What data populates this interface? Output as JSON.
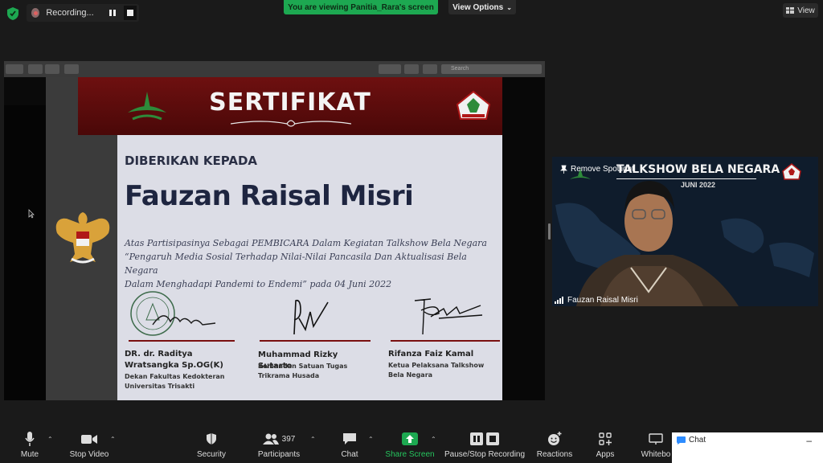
{
  "recording": {
    "label": "Recording..."
  },
  "banner": {
    "viewing": "You are viewing Panitia_Rara's screen",
    "view_options": "View Options"
  },
  "view_button": "View",
  "pdf": {
    "search_placeholder": "Search"
  },
  "certificate": {
    "title": "SERTIFIKAT",
    "given_to": "DIBERIKAN KEPADA",
    "recipient": "Fauzan Raisal Misri",
    "description_lines": [
      "Atas Partisipasinya Sebagai PEMBICARA Dalam Kegiatan Talkshow Bela Negara",
      "“Pengaruh Media Sosial Terhadap Nilai-Nilai Pancasila Dan Aktualisasi Bela Negara",
      "Dalam Menghadapi Pandemi to Endemi” pada 04 Juni 2022"
    ],
    "signatories": [
      {
        "name": "DR. dr. Raditya Wratsangka Sp.OG(K)",
        "role": "Dekan Fakultas Kedokteran Universitas Trisakti"
      },
      {
        "name": "Muhammad Rizky Sutarto",
        "role": "Komandan Satuan Tugas Trikrama Husada"
      },
      {
        "name": "Rifanza Faiz Kamal",
        "role": "Ketua Pelaksana Talkshow Bela Negara"
      }
    ]
  },
  "video": {
    "remove_spotlight": "Remove Spotlight",
    "banner_title": "TALKSHOW BELA NEGARA",
    "banner_date": "JUNI 2022",
    "participant_name": "Fauzan Raisal Misri"
  },
  "toolbar": {
    "mute": "Mute",
    "stop_video": "Stop Video",
    "security": "Security",
    "participants": "Participants",
    "participants_count": "397",
    "chat": "Chat",
    "share_screen": "Share Screen",
    "pause_stop_recording": "Pause/Stop Recording",
    "reactions": "Reactions",
    "apps": "Apps",
    "whiteboard": "Whitebo"
  },
  "chat_panel": {
    "title": "Chat"
  },
  "colors": {
    "share_green": "#1da851",
    "cert_red": "#6e1010",
    "cert_body": "#dcdde6"
  }
}
